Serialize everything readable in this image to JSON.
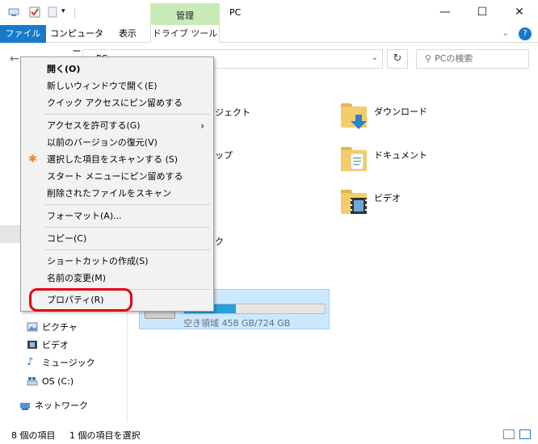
{
  "titlebar": {
    "context_tab_group": "管理",
    "title": "PC",
    "minimize": "—",
    "maximize": "☐",
    "close": "✕"
  },
  "ribbon": {
    "tabs": [
      "ファイル",
      "コンピューター",
      "表示",
      "ドライブ ツール"
    ],
    "collapse": "⌄",
    "help": "?"
  },
  "address": {
    "back": "←",
    "path": "› PC",
    "refresh": "↻",
    "search_placeholder": "PCの検索"
  },
  "navpane": {
    "items": [
      "ピクチャ",
      "ビデオ",
      "ミュージック",
      "OS (C:)",
      "ネットワーク"
    ]
  },
  "main": {
    "folders": [
      "ダウンロード",
      "ドキュメント",
      "ビデオ"
    ],
    "partial_labels": [
      "ジェクト",
      "ップ",
      "ク"
    ],
    "drive": {
      "free_text": "空き領域 458 GB/724 GB",
      "used_fraction": 0.37
    }
  },
  "context_menu": {
    "items": [
      "開く(O)",
      "新しいウィンドウで開く(E)",
      "クイック アクセスにピン留めする",
      "アクセスを許可する(G)",
      "以前のバージョンの復元(V)",
      "選択した項目をスキャンする (S)",
      "スタート メニューにピン留めする",
      "削除されたファイルをスキャン",
      "フォーマット(A)...",
      "コピー(C)",
      "ショートカットの作成(S)",
      "名前の変更(M)",
      "プロパティ(R)"
    ],
    "submenu_arrow": "›"
  },
  "statusbar": {
    "item_count": "8 個の項目",
    "selected": "1 個の項目を選択"
  },
  "colors": {
    "accent": "#1979ca",
    "highlight": "#e60012",
    "selection": "#cce8ff"
  }
}
